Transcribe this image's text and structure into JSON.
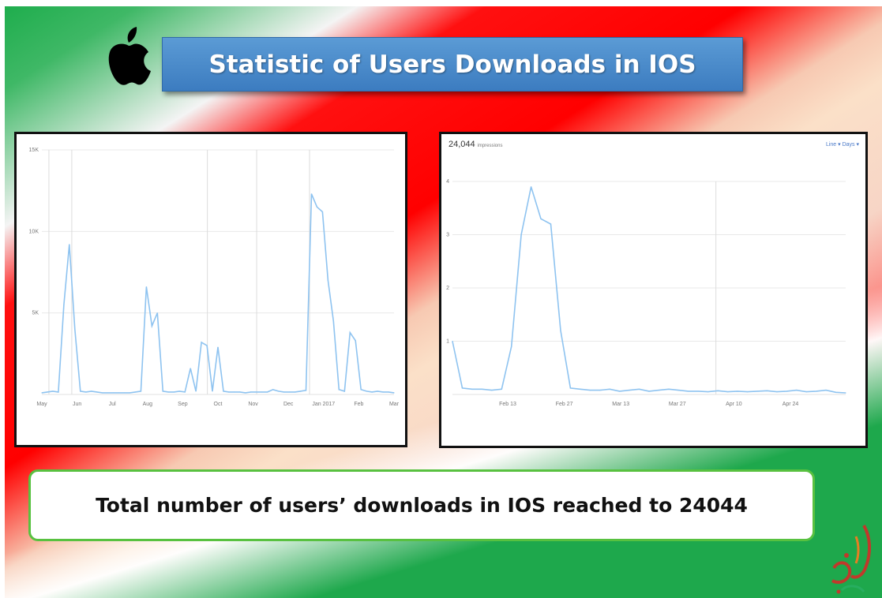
{
  "slide": {
    "title": "Statistic of Users Downloads in IOS",
    "summary": "Total number of users’ downloads in IOS reached to 24044",
    "apple_logo_icon": "apple-icon",
    "brand_logo": "arabic-calligraphy-logo",
    "colors": {
      "title_bg": "#4a8ccc",
      "summary_border": "#58c140",
      "line": "#8ec3f0",
      "flag_red": "#ff0000",
      "flag_green": "#1ea84c"
    }
  },
  "right_panel": {
    "total": "24,044",
    "total_label": "impressions",
    "links": "Line ▾   Days ▾"
  },
  "chart_data": [
    {
      "type": "line",
      "title": "",
      "xlabel": "",
      "ylabel": "",
      "y_ticks": [
        "15K",
        "10K",
        "5K"
      ],
      "x_ticks": [
        "May",
        "Jun",
        "Jul",
        "Aug",
        "Sep",
        "Oct",
        "Nov",
        "Dec",
        "Jan 2017",
        "Feb",
        "Mar"
      ],
      "ylim": [
        0,
        15000
      ],
      "grid": true,
      "series": [
        {
          "x": [
            0,
            1,
            2,
            3,
            4,
            5,
            6,
            7,
            8,
            9,
            10,
            11,
            12,
            13,
            14,
            15,
            16,
            17,
            18,
            19,
            20,
            21,
            22,
            23,
            24,
            25,
            26,
            27,
            28,
            29,
            30,
            31,
            32,
            33,
            34,
            35,
            36,
            37,
            38,
            39,
            40,
            41,
            42,
            43,
            44,
            45,
            46,
            47,
            48,
            49,
            50,
            51,
            52,
            53,
            54,
            55,
            56,
            57,
            58,
            59,
            60,
            61,
            62,
            63,
            64
          ],
          "y": [
            100,
            150,
            200,
            150,
            5500,
            9200,
            4000,
            200,
            150,
            200,
            150,
            100,
            100,
            100,
            100,
            100,
            100,
            150,
            200,
            6600,
            4200,
            5000,
            200,
            150,
            150,
            200,
            150,
            1600,
            200,
            3200,
            3000,
            200,
            2900,
            200,
            150,
            150,
            150,
            100,
            150,
            150,
            150,
            150,
            300,
            200,
            150,
            150,
            150,
            200,
            250,
            12300,
            11500,
            11200,
            7000,
            4500,
            300,
            200,
            3800,
            3300,
            300,
            200,
            150,
            200,
            150,
            150,
            100
          ]
        }
      ]
    },
    {
      "type": "line",
      "title": "",
      "xlabel": "",
      "ylabel": "",
      "y_ticks": [
        "4",
        "3",
        "2",
        "1"
      ],
      "x_ticks": [
        "Feb 13",
        "Feb 27",
        "Mar 13",
        "Mar 27",
        "Apr 10",
        "Apr 24"
      ],
      "ylim": [
        0,
        4
      ],
      "grid": true,
      "series": [
        {
          "x": [
            0,
            1,
            2,
            3,
            4,
            5,
            6,
            7,
            8,
            9,
            10,
            11,
            12,
            13,
            14,
            15,
            16,
            17,
            18,
            19,
            20,
            21,
            22,
            23,
            24,
            25,
            26,
            27,
            28,
            29,
            30,
            31,
            32,
            33,
            34,
            35,
            36,
            37,
            38,
            39,
            40
          ],
          "y": [
            1.0,
            0.12,
            0.1,
            0.1,
            0.08,
            0.1,
            0.9,
            3.0,
            3.9,
            3.3,
            3.2,
            1.2,
            0.12,
            0.1,
            0.08,
            0.08,
            0.1,
            0.06,
            0.08,
            0.1,
            0.06,
            0.08,
            0.1,
            0.08,
            0.06,
            0.06,
            0.05,
            0.07,
            0.05,
            0.06,
            0.05,
            0.06,
            0.07,
            0.05,
            0.06,
            0.08,
            0.05,
            0.06,
            0.08,
            0.04,
            0.03
          ]
        }
      ]
    }
  ]
}
